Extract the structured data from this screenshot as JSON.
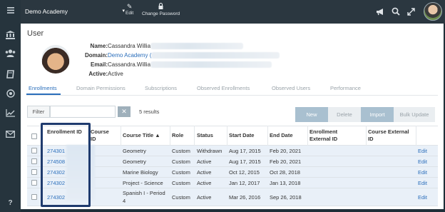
{
  "topbar": {
    "school": "Demo Academy",
    "edit": "Edit",
    "change_password": "Change Password"
  },
  "page": {
    "title": "User"
  },
  "user": {
    "name_label": "Name:",
    "name": "Cassandra Willia",
    "domain_label": "Domain:",
    "domain": "Demo Academy (",
    "email_label": "Email:",
    "email": "Cassandra.Willia",
    "active_label": "Active:",
    "active": "Active"
  },
  "tabs": [
    "Enrollments",
    "Domain Permissions",
    "Subscriptions",
    "Observed Enrollments",
    "Observed Users",
    "Performance"
  ],
  "toolbar": {
    "filter_label": "Filter",
    "results": "5 results",
    "new": "New",
    "delete": "Delete",
    "import": "Import",
    "bulk_update": "Bulk Update",
    "clear_icon": "close-icon"
  },
  "table": {
    "headers": {
      "enrollment_id": "Enrollment ID",
      "course_id": "Course ID",
      "course_title": "Course Title ▲",
      "role": "Role",
      "status": "Status",
      "start_date": "Start Date",
      "end_date": "End Date",
      "enrollment_external_id": "Enrollment External ID",
      "course_external_id": "Course External ID"
    },
    "rows": [
      {
        "id": "274301",
        "title": "Geometry",
        "title2": "",
        "role": "Custom",
        "status": "Withdrawn",
        "start": "Aug 17, 2015",
        "end": "Feb 20, 2021",
        "edit": "Edit"
      },
      {
        "id": "274508",
        "title": "Geometry",
        "title2": "",
        "role": "Custom",
        "status": "Active",
        "start": "Aug 17, 2015",
        "end": "Feb 20, 2021",
        "edit": "Edit"
      },
      {
        "id": "274302",
        "title": "Marine Biology",
        "title2": "",
        "role": "Custom",
        "status": "Active",
        "start": "Oct 12, 2015",
        "end": "Oct 28, 2018",
        "edit": "Edit"
      },
      {
        "id": "274302",
        "title": "Project - Science",
        "title2": "",
        "role": "Custom",
        "status": "Active",
        "start": "Jan 12, 2017",
        "end": "Jan 13, 2018",
        "edit": "Edit"
      },
      {
        "id": "274302",
        "title": "Spanish I - Period",
        "title2": "4",
        "role": "Custom",
        "status": "Active",
        "start": "Mar 26, 2016",
        "end": "Sep 26, 2018",
        "edit": "Edit"
      }
    ]
  },
  "icons": {
    "menu": "hamburger-icon",
    "school": "bank-icon",
    "users": "users-icon",
    "book": "book-icon",
    "target": "target-icon",
    "chart": "chart-icon",
    "mail": "mail-icon",
    "help": "help-icon",
    "megaphone": "megaphone-icon",
    "search": "search-icon",
    "expand": "expand-icon"
  },
  "colors": {
    "accent": "#2a6ebb",
    "topbar": "#2b3740",
    "row": "#e9f0f8",
    "highlight": "#1f3b6e"
  }
}
